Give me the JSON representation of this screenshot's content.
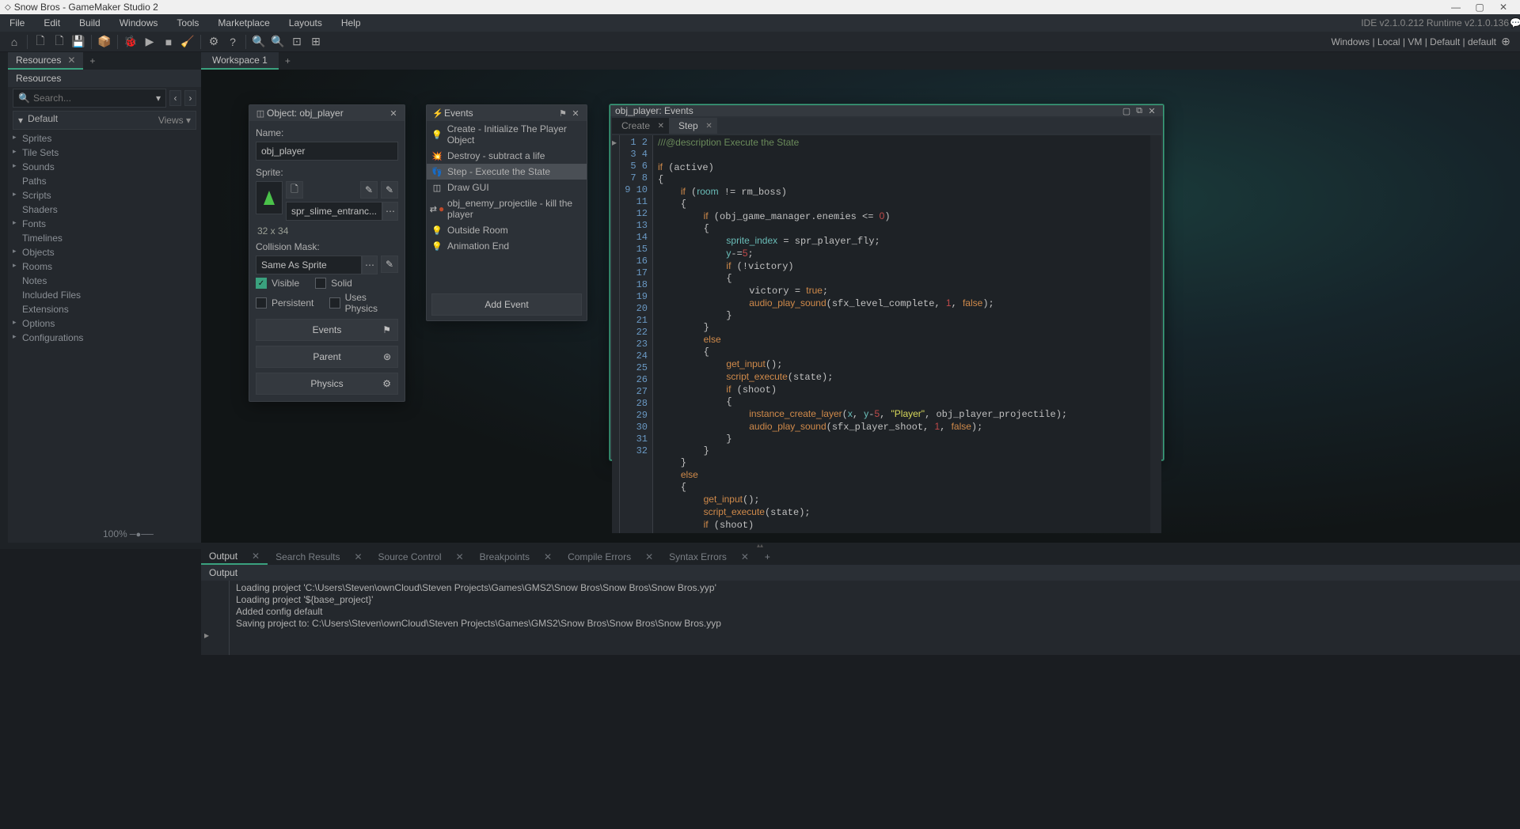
{
  "titlebar": {
    "title": "Snow Bros - GameMaker Studio 2"
  },
  "menubar": {
    "items": [
      "File",
      "Edit",
      "Build",
      "Windows",
      "Tools",
      "Marketplace",
      "Layouts",
      "Help"
    ],
    "runtime": "IDE v2.1.0.212 Runtime v2.1.0.136"
  },
  "toolbar": {
    "targets": "Windows  |  Local  |  VM  |  Default  |  default"
  },
  "resources": {
    "tabtitle": "Resources",
    "header": "Resources",
    "search_placeholder": "Search...",
    "filter": "Default",
    "views": "Views ▾",
    "tree": [
      "Sprites",
      "Tile Sets",
      "Sounds",
      "Paths",
      "Scripts",
      "Shaders",
      "Fonts",
      "Timelines",
      "Objects",
      "Rooms",
      "Notes",
      "Included Files",
      "Extensions",
      "Options",
      "Configurations"
    ],
    "zoom": "100%"
  },
  "workspace": {
    "tab": "Workspace 1"
  },
  "objwin": {
    "title": "Object: obj_player",
    "name_label": "Name:",
    "name_value": "obj_player",
    "sprite_label": "Sprite:",
    "sprite_name": "spr_slime_entranc...",
    "sprite_dim": "32 x 34",
    "collision_label": "Collision Mask:",
    "collision_value": "Same As Sprite",
    "chk_visible": "Visible",
    "chk_solid": "Solid",
    "chk_persistent": "Persistent",
    "chk_physics": "Uses Physics",
    "btn_events": "Events",
    "btn_parent": "Parent",
    "btn_physics": "Physics"
  },
  "eventswin": {
    "title": "Events",
    "items": [
      {
        "icon": "💡",
        "label": "Create - Initialize The Player Object"
      },
      {
        "icon": "💥",
        "label": "Destroy - subtract a life"
      },
      {
        "icon": "👣",
        "label": "Step - Execute the State",
        "selected": true
      },
      {
        "icon": "◫",
        "label": "Draw GUI"
      },
      {
        "icon": "⇄",
        "label": "obj_enemy_projectile - kill the player",
        "red": true
      },
      {
        "icon": "💡",
        "label": "Outside Room"
      },
      {
        "icon": "💡",
        "label": "Animation End"
      }
    ],
    "add": "Add Event"
  },
  "codewin": {
    "title": "obj_player: Events",
    "tabs": [
      {
        "label": "Create",
        "active": false
      },
      {
        "label": "Step",
        "active": true
      }
    ],
    "lines": 32
  },
  "output": {
    "tabs": [
      "Output",
      "Search Results",
      "Source Control",
      "Breakpoints",
      "Compile Errors",
      "Syntax Errors"
    ],
    "header": "Output",
    "lines": [
      "Loading project 'C:\\Users\\Steven\\ownCloud\\Steven Projects\\Games\\GMS2\\Snow Bros\\Snow Bros\\Snow Bros.yyp'",
      "Loading project '${base_project}'",
      "Added config default",
      "Saving project to: C:\\Users\\Steven\\ownCloud\\Steven Projects\\Games\\GMS2\\Snow Bros\\Snow Bros\\Snow Bros.yyp"
    ]
  }
}
